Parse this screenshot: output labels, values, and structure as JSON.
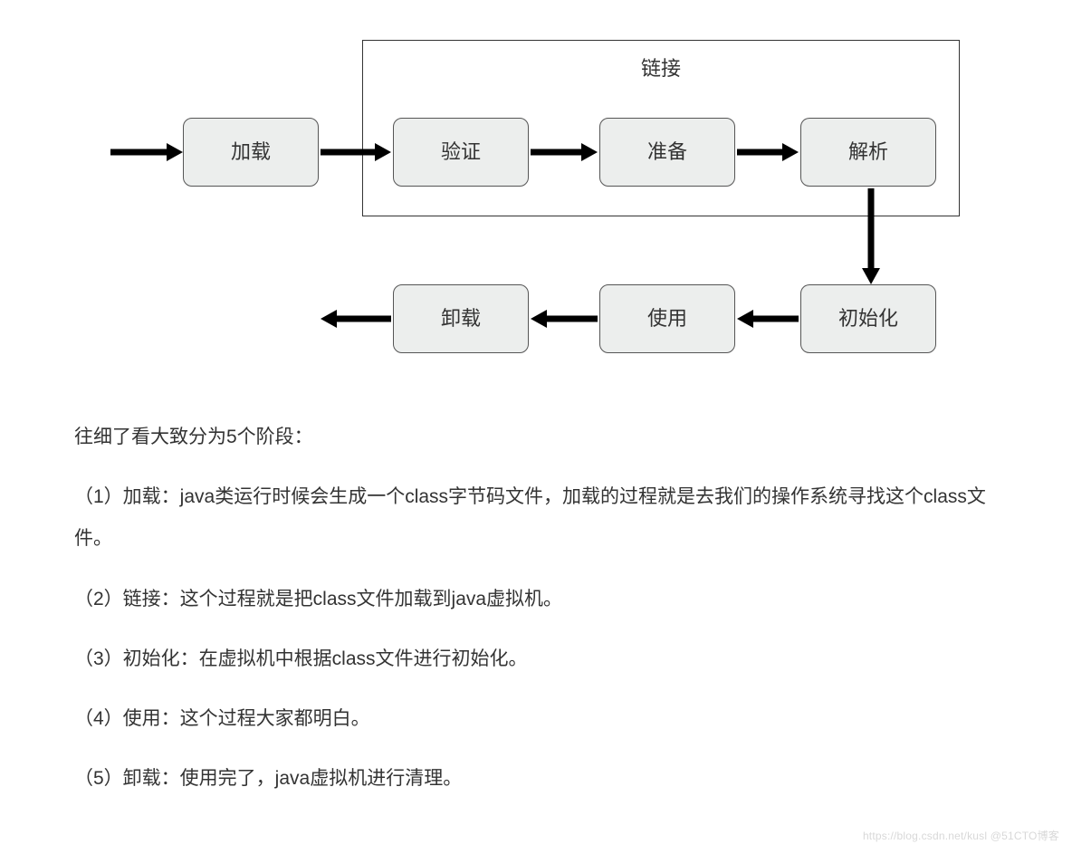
{
  "diagram": {
    "link_group_title": "链接",
    "top_row": {
      "load": "加载",
      "verify": "验证",
      "prepare": "准备",
      "resolve": "解析"
    },
    "bottom_row": {
      "unload": "卸载",
      "use": "使用",
      "init": "初始化"
    }
  },
  "text": {
    "intro": "往细了看大致分为5个阶段：",
    "p1": "（1）加载：java类运行时候会生成一个class字节码文件，加载的过程就是去我们的操作系统寻找这个class文件。",
    "p2": "（2）链接：这个过程就是把class文件加载到java虚拟机。",
    "p3": "（3）初始化：在虚拟机中根据class文件进行初始化。",
    "p4": "（4）使用：这个过程大家都明白。",
    "p5": "（5）卸载：使用完了，java虚拟机进行清理。"
  },
  "watermark": "https://blog.csdn.net/kusl @51CTO博客"
}
